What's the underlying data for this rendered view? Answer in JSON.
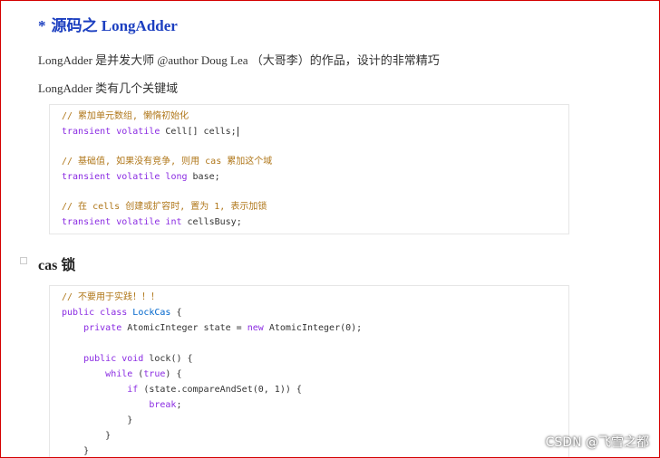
{
  "title": {
    "prefix": "*",
    "text": "源码之 LongAdder"
  },
  "paragraphs": [
    "LongAdder 是并发大师 @author Doug Lea （大哥李）的作品，设计的非常精巧",
    "LongAdder 类有几个关键域"
  ],
  "code_block_1": {
    "lines": [
      "// 累加单元数组, 懒惰初始化",
      "transient volatile Cell[] cells;",
      "",
      "// 基础值, 如果没有竞争, 则用 cas 累加这个域",
      "transient volatile long base;",
      "",
      "// 在 cells 创建或扩容时, 置为 1, 表示加锁",
      "transient volatile int cellsBusy;"
    ]
  },
  "section_heading": "cas 锁",
  "code_block_2": {
    "lines": [
      "// 不要用于实践！！！",
      "public class LockCas {",
      "    private AtomicInteger state = new AtomicInteger(0);",
      "",
      "    public void lock() {",
      "        while (true) {",
      "            if (state.compareAndSet(0, 1)) {",
      "                break;",
      "            }",
      "        }",
      "    }"
    ]
  },
  "watermark": "CSDN @飞雪之都",
  "top_right_hint": "ꟷ"
}
